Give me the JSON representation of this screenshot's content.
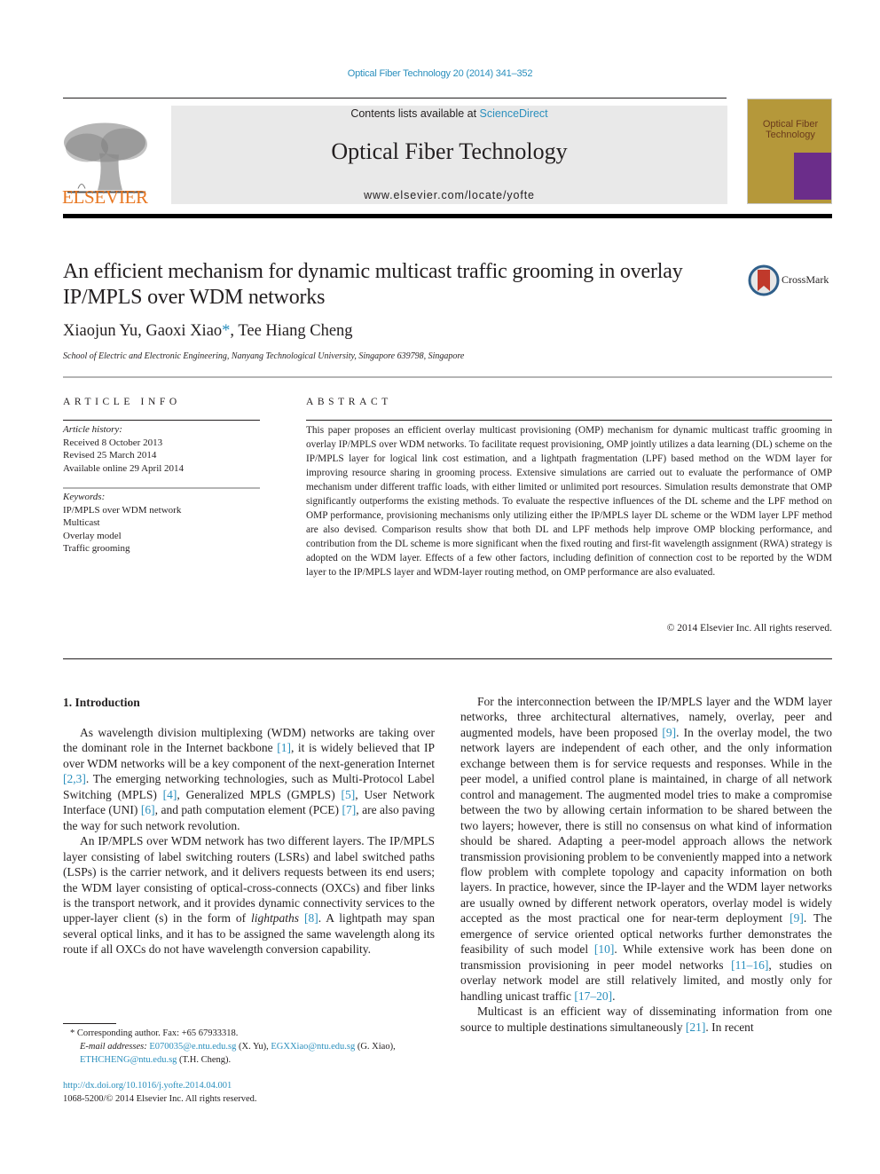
{
  "header": {
    "journal_reference": "Optical Fiber Technology 20 (2014) 341–352",
    "contents_prefix": "Contents lists available at ",
    "contents_link": "ScienceDirect",
    "journal_title": "Optical Fiber Technology",
    "journal_url": "www.elsevier.com/locate/yofte",
    "publisher_logo_text": "ELSEVIER",
    "cover_title": "Optical Fiber Technology",
    "colors": {
      "link": "#2a8fbd",
      "elsevier_orange": "#e87722",
      "cover_gold": "#b5983a",
      "cover_purple": "#6b2d8a"
    }
  },
  "article": {
    "title": "An efficient mechanism for dynamic multicast traffic grooming in overlay IP/MPLS over WDM networks",
    "crossmark_label": "CrossMark",
    "authors": [
      {
        "name": "Xiaojun Yu",
        "sep": ", "
      },
      {
        "name": "Gaoxi Xiao",
        "mark": "*",
        "sep": ", "
      },
      {
        "name": "Tee Hiang Cheng",
        "sep": ""
      }
    ],
    "affiliation": "School of Electric and Electronic Engineering, Nanyang Technological University, Singapore 639798, Singapore"
  },
  "article_info": {
    "heading": "ARTICLE INFO",
    "history_label": "Article history:",
    "history": [
      "Received 8 October 2013",
      "Revised 25 March 2014",
      "Available online 29 April 2014"
    ],
    "keywords_label": "Keywords:",
    "keywords": [
      "IP/MPLS over WDM network",
      "Multicast",
      "Overlay model",
      "Traffic grooming"
    ]
  },
  "abstract": {
    "heading": "ABSTRACT",
    "text": "This paper proposes an efficient overlay multicast provisioning (OMP) mechanism for dynamic multicast traffic grooming in overlay IP/MPLS over WDM networks. To facilitate request provisioning, OMP jointly utilizes a data learning (DL) scheme on the IP/MPLS layer for logical link cost estimation, and a lightpath fragmentation (LPF) based method on the WDM layer for improving resource sharing in grooming process. Extensive simulations are carried out to evaluate the performance of OMP mechanism under different traffic loads, with either limited or unlimited port resources. Simulation results demonstrate that OMP significantly outperforms the existing methods. To evaluate the respective influences of the DL scheme and the LPF method on OMP performance, provisioning mechanisms only utilizing either the IP/MPLS layer DL scheme or the WDM layer LPF method are also devised. Comparison results show that both DL and LPF methods help improve OMP blocking performance, and contribution from the DL scheme is more significant when the fixed routing and first-fit wavelength assignment (RWA) strategy is adopted on the WDM layer. Effects of a few other factors, including definition of connection cost to be reported by the WDM layer to the IP/MPLS layer and WDM-layer routing method, on OMP performance are also evaluated.",
    "copyright": "© 2014 Elsevier Inc. All rights reserved."
  },
  "body": {
    "section_heading": "1. Introduction",
    "left_paragraphs": [
      [
        {
          "t": "As wavelength division multiplexing (WDM) networks are taking over the dominant role in the Internet backbone "
        },
        {
          "c": "[1]"
        },
        {
          "t": ", it is widely believed that IP over WDM networks will be a key component of the next-generation Internet "
        },
        {
          "c": "[2,3]"
        },
        {
          "t": ". The emerging networking technologies, such as Multi-Protocol Label Switching (MPLS) "
        },
        {
          "c": "[4]"
        },
        {
          "t": ", Generalized MPLS (GMPLS) "
        },
        {
          "c": "[5]"
        },
        {
          "t": ", User Network Interface (UNI) "
        },
        {
          "c": "[6]"
        },
        {
          "t": ", and path computation element (PCE) "
        },
        {
          "c": "[7]"
        },
        {
          "t": ", are also paving the way for such network revolution."
        }
      ],
      [
        {
          "t": "An IP/MPLS over WDM network has two different layers. The IP/MPLS layer consisting of label switching routers (LSRs) and label switched paths (LSPs) is the carrier network, and it delivers requests between its end users; the WDM layer consisting of optical-cross-connects (OXCs) and fiber links is the transport network, and it provides dynamic connectivity services to the upper-layer client (s) in the form of "
        },
        {
          "i": "lightpaths"
        },
        {
          "t": " "
        },
        {
          "c": "[8]"
        },
        {
          "t": ". A lightpath may span several optical links, and it has to be assigned the same wavelength along its route if all OXCs do not have wavelength conversion capability."
        }
      ]
    ],
    "right_paragraphs": [
      [
        {
          "t": "For the interconnection between the IP/MPLS layer and the WDM layer networks, three architectural alternatives, namely, overlay, peer and augmented models, have been proposed "
        },
        {
          "c": "[9]"
        },
        {
          "t": ". In the overlay model, the two network layers are independent of each other, and the only information exchange between them is for service requests and responses. While in the peer model, a unified control plane is maintained, in charge of all network control and management. The augmented model tries to make a compromise between the two by allowing certain information to be shared between the two layers; however, there is still no consensus on what kind of information should be shared. Adapting a peer-model approach allows the network transmission provisioning problem to be conveniently mapped into a network flow problem with complete topology and capacity information on both layers. In practice, however, since the IP-layer and the WDM layer networks are usually owned by different network operators, overlay model is widely accepted as the most practical one for near-term deployment "
        },
        {
          "c": "[9]"
        },
        {
          "t": ". The emergence of service oriented optical networks further demonstrates the feasibility of such model "
        },
        {
          "c": "[10]"
        },
        {
          "t": ". While extensive work has been done on transmission provisioning in peer model networks "
        },
        {
          "c": "[11–16]"
        },
        {
          "t": ", studies on overlay network model are still relatively limited, and mostly only for handling unicast traffic "
        },
        {
          "c": "[17–20]"
        },
        {
          "t": "."
        }
      ],
      [
        {
          "t": "Multicast is an efficient way of disseminating information from one source to multiple destinations simultaneously "
        },
        {
          "c": "[21]"
        },
        {
          "t": ". In recent"
        }
      ]
    ]
  },
  "footnotes": {
    "corresponding": "* Corresponding author. Fax: +65 67933318.",
    "email_label": "E-mail addresses:",
    "emails": [
      {
        "address": "E070035@e.ntu.edu.sg",
        "who": " (X. Yu), "
      },
      {
        "address": "EGXXiao@ntu.edu.sg",
        "who": " (G. Xiao),"
      },
      {
        "address": "ETHCHENG@ntu.edu.sg",
        "who": " (T.H. Cheng)."
      }
    ],
    "doi": "http://dx.doi.org/10.1016/j.yofte.2014.04.001",
    "issn_line": "1068-5200/© 2014 Elsevier Inc. All rights reserved."
  }
}
